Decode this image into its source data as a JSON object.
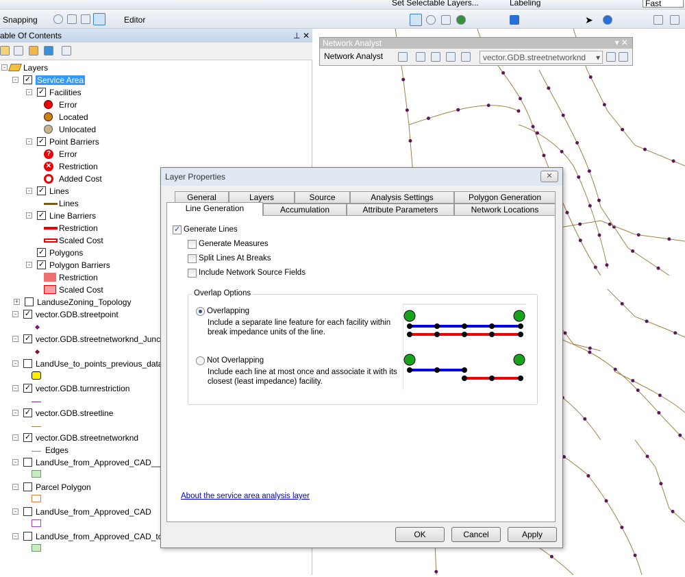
{
  "toolbar_top": {
    "selectable_layers": "Set Selectable Layers...",
    "labeling": "Labeling",
    "quality": "Fast"
  },
  "toolbar_second": {
    "snapping": "Snapping",
    "editor": "Editor"
  },
  "toc": {
    "title": "able Of Contents",
    "items": [
      {
        "level": 0,
        "label": "Layers",
        "type": "group",
        "expand": "-"
      },
      {
        "level": 1,
        "label": "Service Area",
        "type": "layer",
        "expand": "-",
        "checked": true,
        "selected": true
      },
      {
        "level": 2,
        "label": "Facilities",
        "type": "layer",
        "expand": "-",
        "checked": true
      },
      {
        "level": 3,
        "label": "Error",
        "type": "sym",
        "sym": "red-circle"
      },
      {
        "level": 3,
        "label": "Located",
        "type": "sym",
        "sym": "brown-circle"
      },
      {
        "level": 3,
        "label": "Unlocated",
        "type": "sym",
        "sym": "unlocated"
      },
      {
        "level": 2,
        "label": "Point Barriers",
        "type": "layer",
        "expand": "-",
        "checked": true
      },
      {
        "level": 3,
        "label": "Error",
        "type": "sym",
        "sym": "red-question"
      },
      {
        "level": 3,
        "label": "Restriction",
        "type": "sym",
        "sym": "red-x"
      },
      {
        "level": 3,
        "label": "Added Cost",
        "type": "sym",
        "sym": "red-ring"
      },
      {
        "level": 2,
        "label": "Lines",
        "type": "layer",
        "expand": "-",
        "checked": true
      },
      {
        "level": 3,
        "label": "Lines",
        "type": "sym",
        "sym": "brown-line"
      },
      {
        "level": 2,
        "label": "Line Barriers",
        "type": "layer",
        "expand": "-",
        "checked": true
      },
      {
        "level": 3,
        "label": "Restriction",
        "type": "sym",
        "sym": "red-line"
      },
      {
        "level": 3,
        "label": "Scaled Cost",
        "type": "sym",
        "sym": "red-hollow-line"
      },
      {
        "level": 2,
        "label": "Polygons",
        "type": "layer",
        "expand": "",
        "checked": true
      },
      {
        "level": 2,
        "label": "Polygon Barriers",
        "type": "layer",
        "expand": "-",
        "checked": true
      },
      {
        "level": 3,
        "label": "Restriction",
        "type": "sym",
        "sym": "red-poly"
      },
      {
        "level": 3,
        "label": "Scaled Cost",
        "type": "sym",
        "sym": "red-poly2"
      },
      {
        "level": 1,
        "label": "LanduseZoning_Topology",
        "type": "layer",
        "expand": "+",
        "checked": false
      },
      {
        "level": 1,
        "label": "vector.GDB.streetpoint",
        "type": "layer",
        "expand": "-",
        "checked": true
      },
      {
        "level": 2,
        "label": "",
        "type": "sym",
        "sym": "purple-dot"
      },
      {
        "level": 1,
        "label": "vector.GDB.streetnetworknd_Junct",
        "type": "layer",
        "expand": "-",
        "checked": true
      },
      {
        "level": 2,
        "label": "",
        "type": "sym",
        "sym": "maroon-dot"
      },
      {
        "level": 1,
        "label": "LandUse_to_points_previous_data",
        "type": "layer",
        "expand": "-",
        "checked": false
      },
      {
        "level": 2,
        "label": "",
        "type": "sym",
        "sym": "yellow-hex"
      },
      {
        "level": 1,
        "label": "vector.GDB.turnrestriction",
        "type": "layer",
        "expand": "-",
        "checked": true
      },
      {
        "level": 2,
        "label": "",
        "type": "sym",
        "sym": "purple-line"
      },
      {
        "level": 1,
        "label": "vector.GDB.streetline",
        "type": "layer",
        "expand": "-",
        "checked": true
      },
      {
        "level": 2,
        "label": "",
        "type": "sym",
        "sym": "brown-thin-line"
      },
      {
        "level": 1,
        "label": "vector.GDB.streetnetworknd",
        "type": "layer",
        "expand": "-",
        "checked": true
      },
      {
        "level": 2,
        "label": "Edges",
        "type": "sym",
        "sym": "gray-line"
      },
      {
        "level": 1,
        "label": "LandUse_from_Approved_CAD__jo",
        "type": "layer",
        "expand": "-",
        "checked": false
      },
      {
        "level": 2,
        "label": "",
        "type": "sym",
        "sym": "green-box"
      },
      {
        "level": 1,
        "label": "Parcel Polygon",
        "type": "layer",
        "expand": "-",
        "checked": false
      },
      {
        "level": 2,
        "label": "",
        "type": "sym",
        "sym": "orange-box"
      },
      {
        "level": 1,
        "label": "LandUse_from_Approved_CAD",
        "type": "layer",
        "expand": "-",
        "checked": false
      },
      {
        "level": 2,
        "label": "",
        "type": "sym",
        "sym": "purple-box"
      },
      {
        "level": 1,
        "label": "LandUse_from_Approved_CAD_top",
        "type": "layer",
        "expand": "-",
        "checked": false
      },
      {
        "level": 2,
        "label": "",
        "type": "sym",
        "sym": "green-box"
      }
    ]
  },
  "network_analyst": {
    "title": "Network Analyst",
    "menu": "Network Analyst",
    "dataset": "vector.GDB.streetnetworknd"
  },
  "dialog": {
    "title": "Layer Properties",
    "tabs_row1": [
      "General",
      "Layers",
      "Source",
      "Analysis Settings",
      "Polygon Generation"
    ],
    "tabs_row2": [
      "Line Generation",
      "Accumulation",
      "Attribute Parameters",
      "Network Locations"
    ],
    "generate_lines": "Generate Lines",
    "generate_measures": "Generate Measures",
    "split_lines": "Split Lines At Breaks",
    "include_fields": "Include Network Source Fields",
    "overlap_group": "Overlap Options",
    "overlapping": "Overlapping",
    "overlapping_desc1": "Include a separate line feature for each facility within",
    "overlapping_desc2": "break impedance units of the line.",
    "not_overlapping": "Not Overlapping",
    "not_overlapping_desc1": "Include each line at most once and associate it with its",
    "not_overlapping_desc2": "closest (least impedance) facility.",
    "help_link": "About the service area analysis layer",
    "ok": "OK",
    "cancel": "Cancel",
    "apply": "Apply"
  },
  "colors": {
    "selection": "#3399ff",
    "road": "#a08040",
    "junction": "#5a1a5a",
    "facility": "#1aa31a",
    "blue_line": "#0000ee",
    "red_line": "#ee0000"
  }
}
